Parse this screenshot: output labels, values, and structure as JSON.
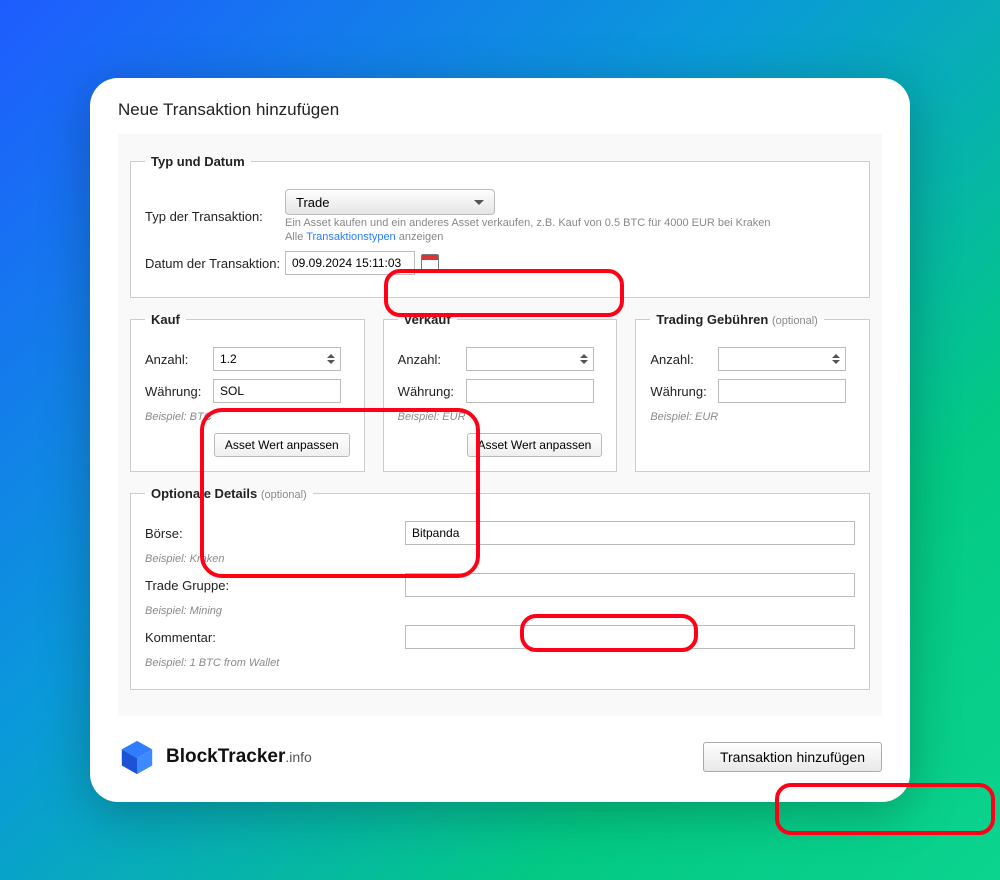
{
  "window": {
    "title": "Neue Transaktion hinzufügen"
  },
  "typeSection": {
    "legend": "Typ und Datum",
    "typeLabel": "Typ der Transaktion:",
    "typeSelected": "Trade",
    "helperPrefix": "Ein Asset kaufen und ein anderes Asset verkaufen, z.B. Kauf von 0.5 BTC für 4000 EUR bei Kraken",
    "showAllPrefix": "Alle",
    "showAllLink": "Transaktionstypen",
    "showAllSuffix": "anzeigen",
    "dateLabel": "Datum der Transaktion:",
    "dateValue": "09.09.2024 15:11:03"
  },
  "kauf": {
    "legend": "Kauf",
    "anzahlLabel": "Anzahl:",
    "anzahlValue": "1.2",
    "waehrungLabel": "Währung:",
    "waehrungValue": "SOL",
    "example": "Beispiel: BTC",
    "adjustBtn": "Asset Wert anpassen"
  },
  "verkauf": {
    "legend": "Verkauf",
    "anzahlLabel": "Anzahl:",
    "anzahlValue": "",
    "waehrungLabel": "Währung:",
    "waehrungValue": "",
    "example": "Beispiel: EUR",
    "adjustBtn": "Asset Wert anpassen"
  },
  "gebuehren": {
    "legend": "Trading Gebühren",
    "optional": "(optional)",
    "anzahlLabel": "Anzahl:",
    "anzahlValue": "",
    "waehrungLabel": "Währung:",
    "waehrungValue": "",
    "example": "Beispiel: EUR"
  },
  "details": {
    "legend": "Optionale Details",
    "optional": "(optional)",
    "boerseLabel": "Börse:",
    "boerseValue": "Bitpanda",
    "boerseExample": "Beispiel: Kraken",
    "gruppeLabel": "Trade Gruppe:",
    "gruppeValue": "",
    "gruppeExample": "Beispiel: Mining",
    "kommentarLabel": "Kommentar:",
    "kommentarValue": "",
    "kommentarExample": "Beispiel: 1 BTC from Wallet"
  },
  "brand": {
    "name": "BlockTracker",
    "suffix": ".info"
  },
  "submit": {
    "label": "Transaktion hinzufügen"
  }
}
